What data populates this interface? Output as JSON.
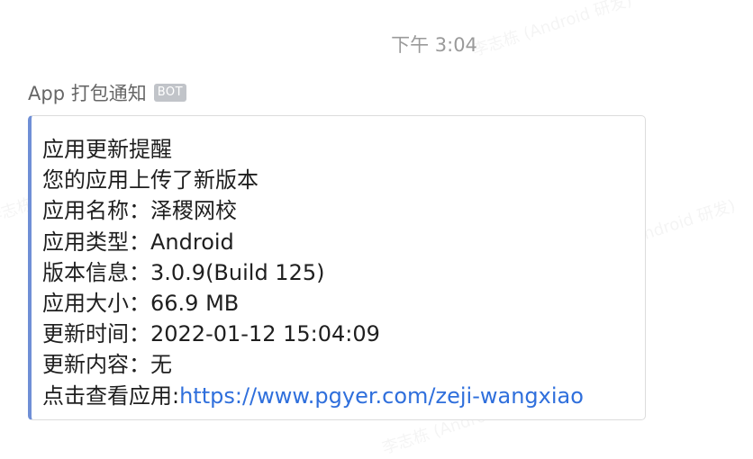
{
  "timestamp": "下午 3:04",
  "sender": {
    "name": "App 打包通知",
    "badge": "BOT"
  },
  "message": {
    "title": "应用更新提醒",
    "subtitle": "您的应用上传了新版本",
    "fields": [
      {
        "label": "应用名称：",
        "value": "泽稷网校"
      },
      {
        "label": "应用类型：",
        "value": "Android"
      },
      {
        "label": "版本信息：",
        "value": "3.0.9(Build 125)"
      },
      {
        "label": "应用大小：",
        "value": "66.9 MB"
      },
      {
        "label": "更新时间：",
        "value": "2022-01-12 15:04:09"
      },
      {
        "label": "更新内容：",
        "value": "无"
      }
    ],
    "link_label": "点击查看应用:",
    "link_url": "https://www.pgyer.com/zeji-wangxiao"
  },
  "colors": {
    "card_accent": "#6f8fd6",
    "link": "#2f6fdc"
  }
}
